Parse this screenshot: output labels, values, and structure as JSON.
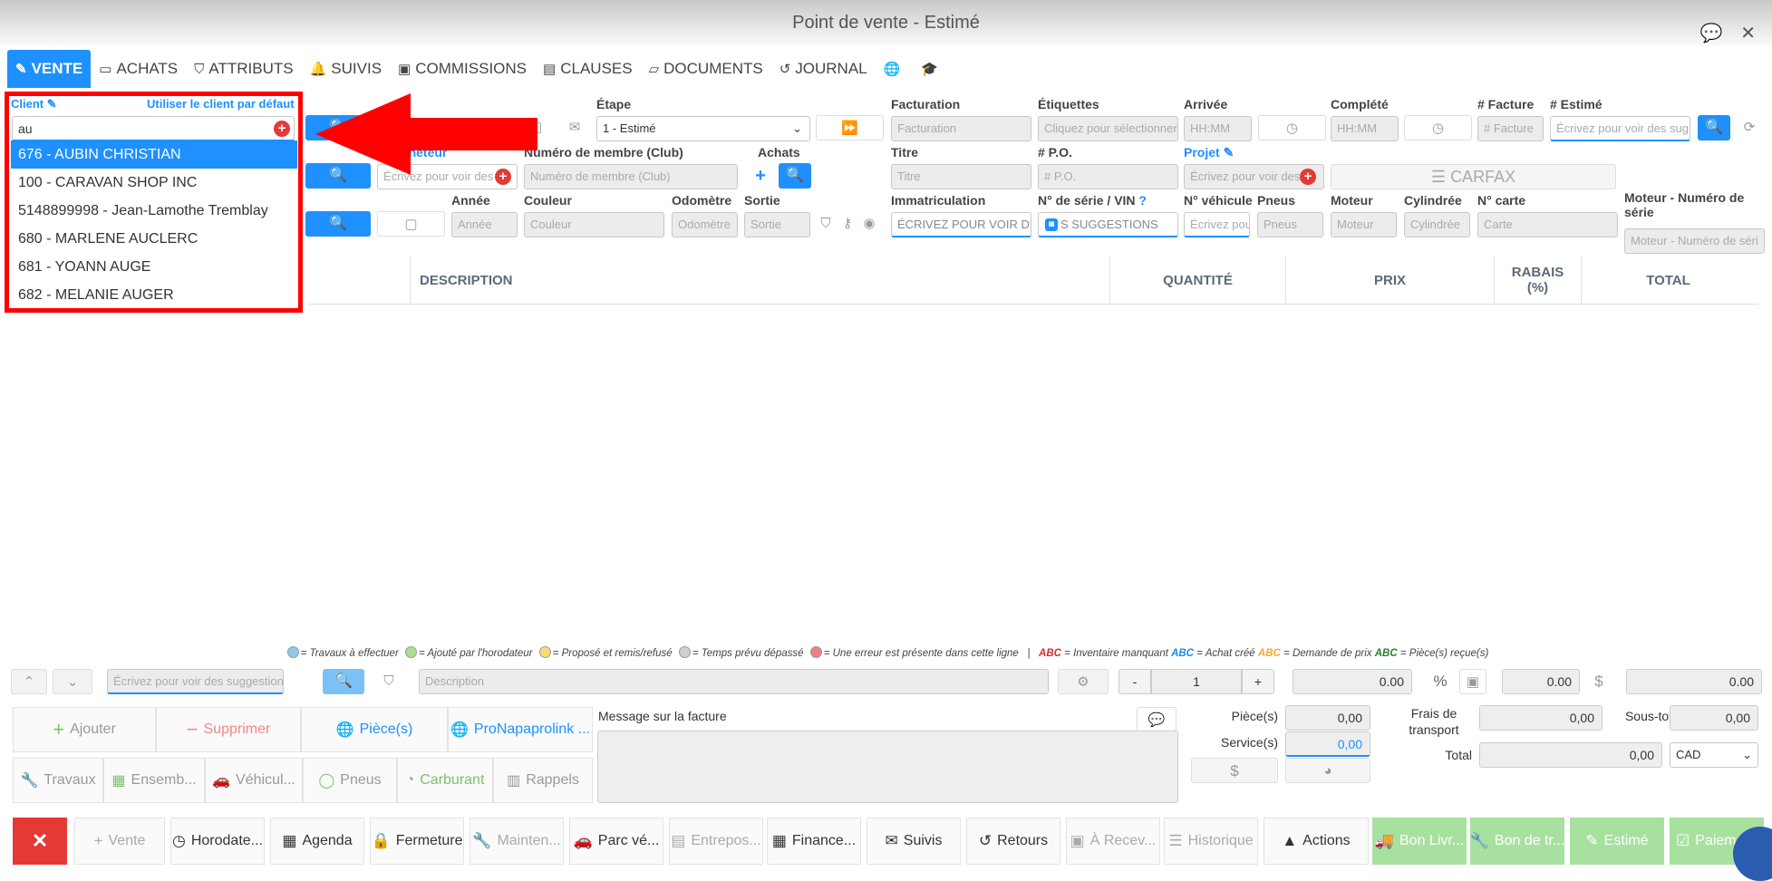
{
  "window": {
    "title": "Point de vente - Estimé"
  },
  "tabs": [
    {
      "label": "VENTE",
      "icon": "edit-icon"
    },
    {
      "label": "ACHATS",
      "icon": "card-icon"
    },
    {
      "label": "ATTRIBUTS",
      "icon": "tags-icon"
    },
    {
      "label": "SUIVIS",
      "icon": "bell-icon"
    },
    {
      "label": "COMMISSIONS",
      "icon": "money-icon"
    },
    {
      "label": "CLAUSES",
      "icon": "file-icon"
    },
    {
      "label": "DOCUMENTS",
      "icon": "folder-icon"
    },
    {
      "label": "JOURNAL",
      "icon": "history-icon"
    }
  ],
  "client": {
    "label": "Client",
    "default_link": "Utiliser le client par défaut",
    "value": "au",
    "suggestions": [
      "676 - AUBIN CHRISTIAN",
      "100 - CARAVAN SHOP INC",
      "5148899998 - Jean-Lamothe Tremblay",
      "680 - MARLENE AUCLERC",
      "681 - YOANN AUGE",
      "682 - MELANIE AUGER"
    ]
  },
  "form": {
    "etape_label": "Étape",
    "etape_value": "1 - Estimé",
    "facturation_label": "Facturation",
    "facturation_ph": "Facturation",
    "etiquettes_label": "Étiquettes",
    "etiquettes_ph": "Cliquez pour sélectionner",
    "arrivee_label": "Arrivée",
    "arrivee_ph": "HH:MM",
    "complete_label": "Complété",
    "complete_ph": "HH:MM",
    "facture_label": "# Facture",
    "facture_ph": "# Facture",
    "estime_label": "# Estimé",
    "estime_ph": "Écrivez pour voir des sug",
    "acheteur_label": "acheteur",
    "acheteur_ph": "Écrivez pour voir des",
    "membre_label": "Numéro de membre (Club)",
    "membre_ph": "Numéro de membre (Club)",
    "achats_label": "Achats",
    "titre_label": "Titre",
    "titre_ph": "Titre",
    "po_label": "# P.O.",
    "po_ph": "# P.O.",
    "projet_label": "Projet",
    "projet_ph": "Écrivez pour voir des",
    "carfax_label": "CARFAX",
    "annee_label": "Année",
    "annee_ph": "Année",
    "couleur_label": "Couleur",
    "couleur_ph": "Couleur",
    "odometre_label": "Odomètre",
    "odometre_ph": "Odomètre",
    "sortie_label": "Sortie",
    "sortie_ph": "Sortie",
    "immat_label": "Immatriculation",
    "immat_ph": "ÉCRIVEZ POUR VOIR DES",
    "vin_label": "N° de série / VIN",
    "vin_ph": "S SUGGESTIONS",
    "vehicule_label": "N° véhicule",
    "vehicule_ph": "Écrivez pou",
    "pneus_label": "Pneus",
    "pneus_ph": "Pneus",
    "moteur_label": "Moteur",
    "moteur_ph": "Moteur",
    "cylindree_label": "Cylindrée",
    "cylindree_ph": "Cylindrée",
    "carte_label": "N° carte",
    "carte_ph": "Carte",
    "moteur_serie_label1": "Moteur - Numéro de",
    "moteur_serie_label2": "série",
    "moteur_serie_ph": "Moteur - Numéro de séri"
  },
  "grid": {
    "columns": [
      "DESCRIPTION",
      "QUANTITÉ",
      "PRIX",
      "RABAIS",
      "(%)",
      "TOTAL"
    ]
  },
  "legend": {
    "items": [
      {
        "color": "#8ec8f0",
        "text": "= Travaux à effectuer"
      },
      {
        "color": "#a8e08e",
        "text": "= Ajouté par l'horodateur"
      },
      {
        "color": "#f7dc6f",
        "text": "= Proposé et remis/refusé"
      },
      {
        "color": "#d0d0d0",
        "text": "= Temps prévu dépassé"
      },
      {
        "color": "#f08080",
        "text": "= Une erreur est présente dans cette ligne"
      }
    ],
    "sep": "|",
    "abc": "ABC",
    "abc_texts": [
      "= Inventaire manquant",
      "= Achat créé",
      "= Demande de prix",
      "= Pièce(s) reçue(s)"
    ],
    "abc_colors": [
      "#d32f2f",
      "#1e88e5",
      "#f9a825",
      "#2e7d32"
    ]
  },
  "line_entry": {
    "search_ph": "Écrivez pour voir des suggestions",
    "description_ph": "Description",
    "minus": "-",
    "qty": "1",
    "plus": "+",
    "price": "0.00",
    "pct": "%",
    "discount": "0.00",
    "dollar": "$",
    "total": "0.00"
  },
  "actions": {
    "ajouter": "Ajouter",
    "supprimer": "Supprimer",
    "pieces": "Pièce(s)",
    "pronapa": "ProNapaprolink ...",
    "travaux": "Travaux",
    "ensemble": "Ensemb...",
    "vehicule": "Véhicul...",
    "pneus": "Pneus",
    "carburant": "Carburant",
    "rappels": "Rappels"
  },
  "message": {
    "label": "Message sur la facture"
  },
  "totals": {
    "pieces_label": "Pièce(s)",
    "pieces": "0,00",
    "service_label": "Service(s)",
    "service": "0,00",
    "frais_label1": "Frais de",
    "frais_label2": "transport",
    "frais": "0,00",
    "soustotal_label": "Sous-total",
    "soustotal": "0,00",
    "total_label": "Total",
    "total": "0,00",
    "currency": "CAD",
    "dollar": "$"
  },
  "bottom": {
    "vente": "Vente",
    "horodate": "Horodate...",
    "agenda": "Agenda",
    "fermeture": "Fermeture",
    "mainten": "Mainten...",
    "parc": "Parc vé...",
    "entrepos": "Entrepos...",
    "finance": "Finance...",
    "suivis": "Suivis",
    "retours": "Retours",
    "arecev": "À Recev...",
    "historique": "Historique",
    "actions": "Actions",
    "bonlivr": "Bon Livr...",
    "bondetr": "Bon de tr...",
    "estime": "Estimé",
    "paiem": "Paiem..."
  },
  "colors": {
    "accent": "#1e90ff",
    "highlight": "#ff0000",
    "green": "#a8e0a0"
  }
}
